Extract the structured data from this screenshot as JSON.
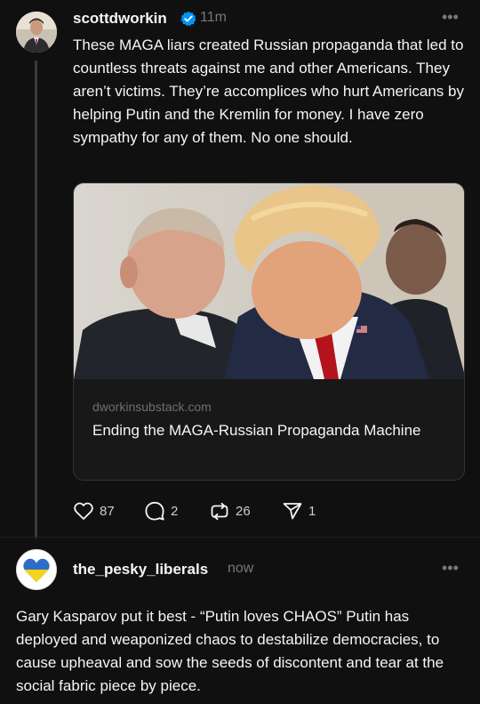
{
  "top_fragment": "• • •",
  "post1": {
    "username": "scottdworkin",
    "time": "11m",
    "more_label": "•••",
    "text": "These MAGA liars created Russian propaganda that led to countless threats against me and other Americans. They aren’t victims. They’re accomplices who hurt Americans by helping Putin and the Kremlin for money. I have zero sympathy for any of them. No one should.",
    "link_card": {
      "domain": "dworkinsubstack.com",
      "title": "Ending the MAGA-Russian Propaganda Machine"
    },
    "actions": {
      "likes": "87",
      "replies": "2",
      "reposts": "26",
      "shares": "1"
    }
  },
  "post2": {
    "username": "the_pesky_liberals",
    "time": "now",
    "more_label": "•••",
    "text": "Gary Kasparov put it best - “Putin loves CHAOS”  Putin has deployed and weaponized chaos to destabilize democracies, to cause upheaval and sow the seeds of discontent and tear at the social fabric piece by piece."
  },
  "colors": {
    "background": "#101010",
    "verified_badge": "#0095f6",
    "muted_text": "#777777"
  },
  "icons": [
    "verified-badge-icon",
    "heart-icon",
    "comment-icon",
    "repost-icon",
    "share-icon",
    "more-icon"
  ]
}
